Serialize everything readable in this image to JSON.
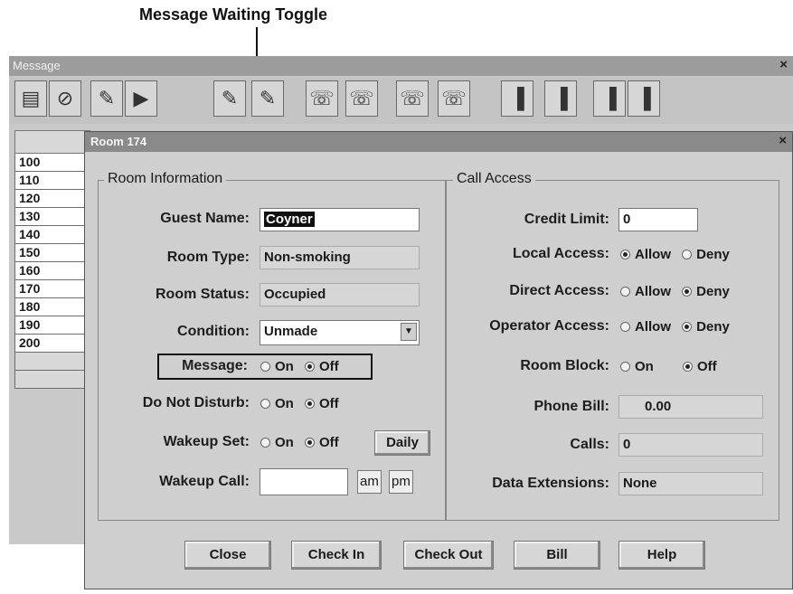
{
  "annotation": {
    "callout": "Message Waiting Toggle"
  },
  "bg_window": {
    "title": "Message",
    "close_glyph": "×",
    "toolbar": [
      "message-board-icon",
      "no-entry-icon",
      "pencil-icon",
      "door-icon",
      "pencil-key-icon",
      "pencil-phone-icon",
      "phone-no-icon",
      "phone-wakeup-icon",
      "phone-dial-icon",
      "phone-multi-icon",
      "door-exit-icon",
      "door-in-icon",
      "door-key-icon",
      "door-check-icon"
    ],
    "rooms": [
      "100",
      "110",
      "120",
      "130",
      "140",
      "150",
      "160",
      "170",
      "180",
      "190",
      "200"
    ]
  },
  "dialog": {
    "title": "Room 174",
    "close_glyph": "×",
    "room_info": {
      "title": "Room Information",
      "guest_name_label": "Guest Name:",
      "guest_name_value": "Coyner",
      "room_type_label": "Room Type:",
      "room_type_value": "Non-smoking",
      "room_status_label": "Room Status:",
      "room_status_value": "Occupied",
      "condition_label": "Condition:",
      "condition_value": "Unmade",
      "message_label": "Message:",
      "dnd_label": "Do Not Disturb:",
      "wakeup_set_label": "Wakeup Set:",
      "daily_label": "Daily",
      "wakeup_call_label": "Wakeup Call:",
      "wakeup_call_value": "",
      "am_label": "am",
      "pm_label": "pm",
      "on_label": "On",
      "off_label": "Off"
    },
    "call_access": {
      "title": "Call Access",
      "credit_limit_label": "Credit Limit:",
      "credit_limit_value": "0",
      "local_access_label": "Local Access:",
      "direct_access_label": "Direct Access:",
      "operator_access_label": "Operator Access:",
      "room_block_label": "Room Block:",
      "phone_bill_label": "Phone Bill:",
      "phone_bill_value": "0.00",
      "calls_label": "Calls:",
      "calls_value": "0",
      "data_ext_label": "Data Extensions:",
      "data_ext_value": "None",
      "allow_label": "Allow",
      "deny_label": "Deny",
      "on_label": "On",
      "off_label": "Off"
    },
    "buttons": {
      "close": "Close",
      "check_in": "Check In",
      "check_out": "Check Out",
      "bill": "Bill",
      "help": "Help"
    }
  }
}
